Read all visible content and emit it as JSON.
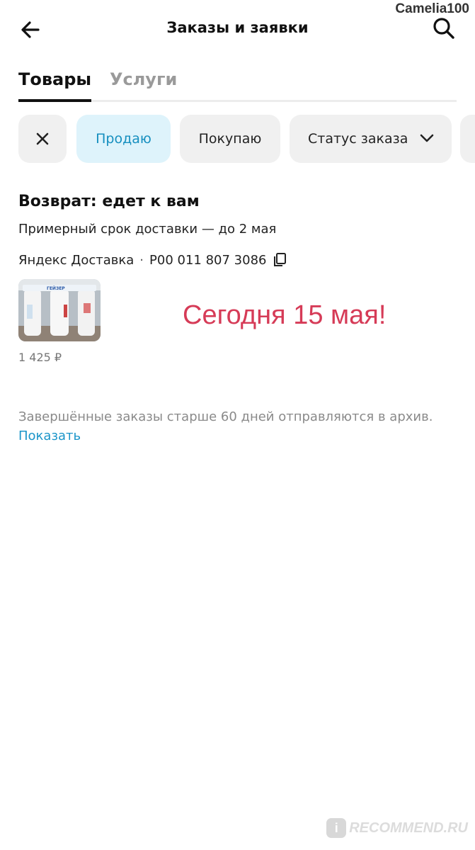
{
  "watermark": {
    "user": "Camelia100",
    "site": "RECOMMEND.RU",
    "site_badge": "i"
  },
  "header": {
    "title": "Заказы и заявки",
    "back_icon": "arrow-left-icon",
    "search_icon": "search-icon"
  },
  "tabs": [
    {
      "label": "Товары",
      "active": true
    },
    {
      "label": "Услуги",
      "active": false
    }
  ],
  "filters": {
    "sell": "Продаю",
    "buy": "Покупаю",
    "status": "Статус заказа"
  },
  "order": {
    "status_title": "Возврат: едет к вам",
    "eta": "Примерный срок доставки — до 2 мая",
    "carrier": "Яндекс Доставка",
    "separator": "·",
    "tracking": "P00 011 807 3086",
    "price": "1 425 ₽",
    "product_brand": "ГЕЙЗЕР"
  },
  "annotation": "Сегодня 15 мая!",
  "archive": {
    "note": "Завершённые заказы старше 60 дней отправляются в архив.",
    "link": "Показать"
  },
  "colors": {
    "accent_link": "#1b95c9",
    "chip_selected_bg": "#def3fb",
    "chip_selected_text": "#168fbf",
    "annotation": "#d63b57"
  }
}
